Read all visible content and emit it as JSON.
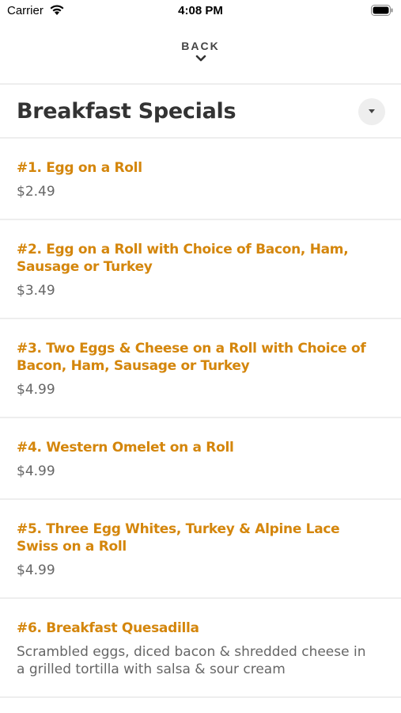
{
  "status_bar": {
    "carrier": "Carrier",
    "time": "4:08 PM"
  },
  "navigation": {
    "back_label": "BACK"
  },
  "section": {
    "title": "Breakfast Specials"
  },
  "colors": {
    "accent": "#d4860c",
    "price_text": "#666666",
    "title_text": "#333333",
    "divider": "#eeeeee"
  },
  "icons": {
    "wifi": "wifi-icon",
    "battery": "battery-icon",
    "back": "chevron-down-icon",
    "dropdown": "caret-down-icon"
  },
  "menu": {
    "items": [
      {
        "name": "#1. Egg on a Roll",
        "price": "$2.49"
      },
      {
        "name": "#2. Egg on a Roll with Choice of Bacon, Ham, Sausage or Turkey",
        "price": "$3.49"
      },
      {
        "name": "#3. Two Eggs & Cheese on a Roll with Choice of Bacon, Ham, Sausage or Turkey",
        "price": "$4.99"
      },
      {
        "name": "#4. Western Omelet on a Roll",
        "price": "$4.99"
      },
      {
        "name": "#5. Three Egg Whites, Turkey & Alpine Lace Swiss on a Roll",
        "price": "$4.99"
      },
      {
        "name": "#6. Breakfast Quesadilla",
        "description": "Scrambled eggs, diced bacon & shredded cheese in a grilled tortilla with salsa & sour cream"
      }
    ]
  }
}
